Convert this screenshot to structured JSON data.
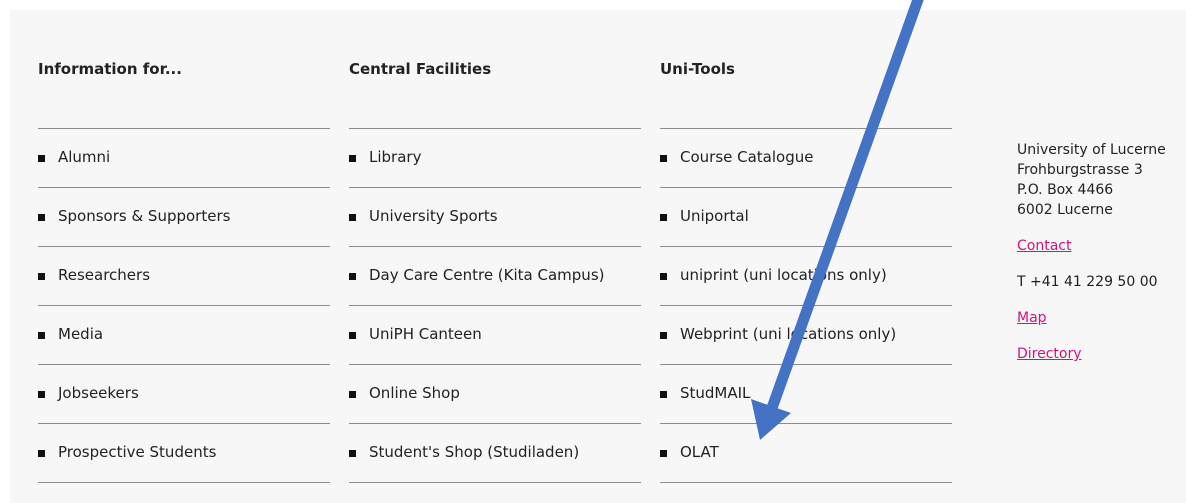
{
  "columns": [
    {
      "title": "Information for...",
      "items": [
        "Alumni",
        "Sponsors & Supporters",
        "Researchers",
        "Media",
        "Jobseekers",
        "Prospective Students"
      ]
    },
    {
      "title": "Central Facilities",
      "items": [
        "Library",
        "University Sports",
        "Day Care Centre (Kita Campus)",
        "UniPH Canteen",
        "Online Shop",
        "Student's Shop (Studiladen)"
      ]
    },
    {
      "title": "Uni-Tools",
      "items": [
        "Course Catalogue",
        "Uniportal",
        "uniprint (uni locations only)",
        "Webprint (uni locations only)",
        "StudMAIL",
        "OLAT"
      ]
    }
  ],
  "address": {
    "lines": [
      "University of Lucerne",
      "Frohburgstrasse 3",
      "P.O. Box 4466",
      "6002 Lucerne"
    ],
    "contact_label": "Contact",
    "phone": "T +41 41 229 50 00",
    "map_label": "Map",
    "directory_label": "Directory"
  },
  "colors": {
    "link": "#d4127e",
    "annotation_arrow": "#4472c4",
    "background": "#f7f7f7"
  }
}
